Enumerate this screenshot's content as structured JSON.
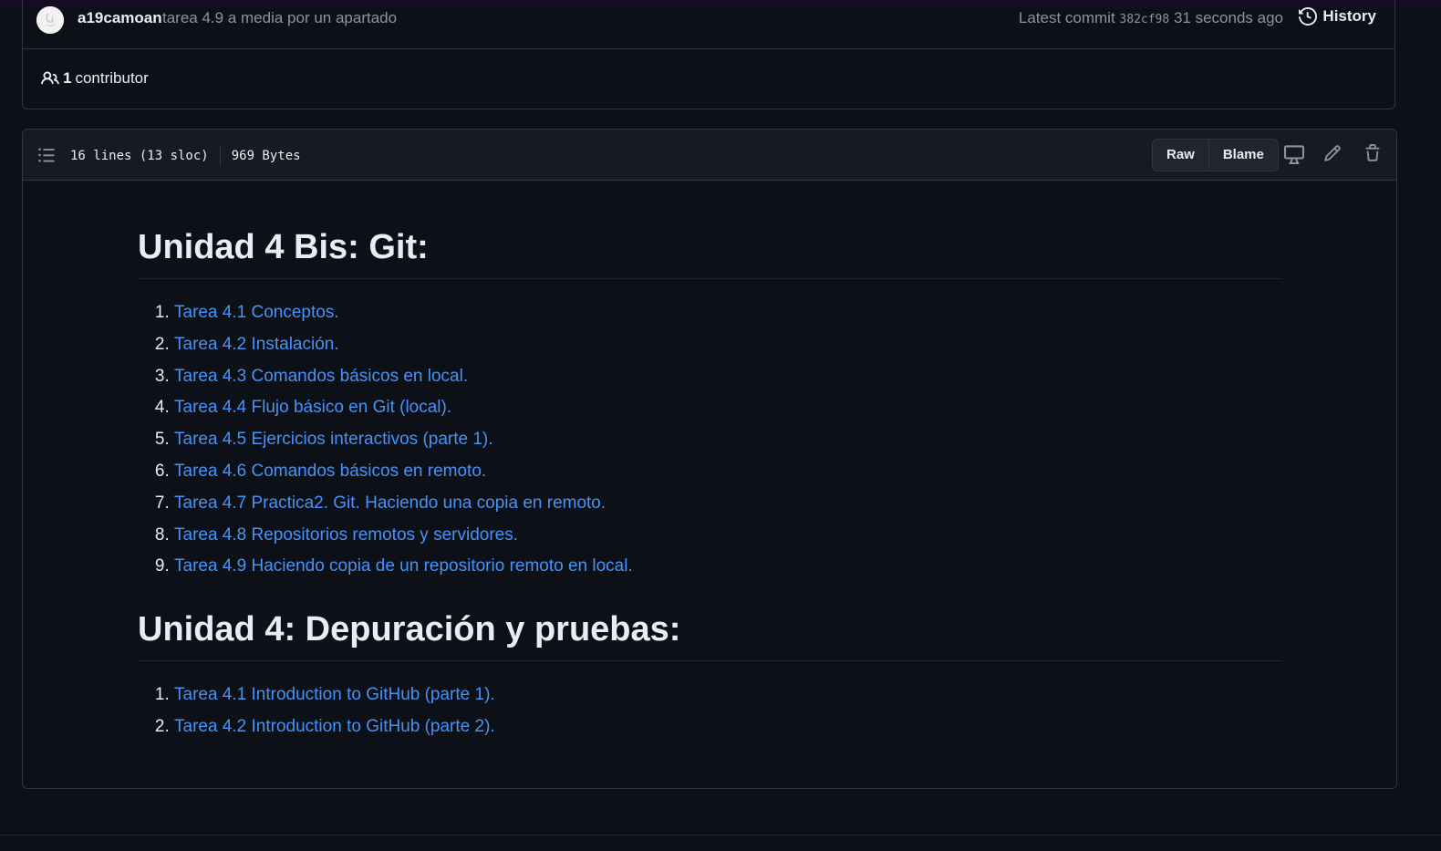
{
  "commit": {
    "author": "a19camoan",
    "message": "tarea 4.9 a media por un apartado",
    "latest_label": "Latest commit",
    "sha": "382cf98",
    "time": "31 seconds ago",
    "history_label": "History"
  },
  "contributors": {
    "count": "1",
    "label": "contributor"
  },
  "file": {
    "lines": "16 lines (13 sloc)",
    "size": "969 Bytes",
    "raw_label": "Raw",
    "blame_label": "Blame"
  },
  "icons": {
    "toc": "list-unordered-icon",
    "display": "desktop-icon",
    "edit": "pencil-icon",
    "delete": "trash-icon",
    "history": "history-icon",
    "people": "people-icon"
  },
  "markdown": {
    "heading1": "Unidad 4 Bis: Git:",
    "list1": [
      "Tarea 4.1 Conceptos.",
      "Tarea 4.2 Instalación.",
      "Tarea 4.3 Comandos básicos en local.",
      "Tarea 4.4 Flujo básico en Git (local).",
      "Tarea 4.5 Ejercicios interactivos (parte 1).",
      "Tarea 4.6 Comandos básicos en remoto.",
      "Tarea 4.7 Practica2. Git. Haciendo una copia en remoto.",
      "Tarea 4.8 Repositorios remotos y servidores.",
      "Tarea 4.9 Haciendo copia de un repositorio remoto en local."
    ],
    "heading2": "Unidad 4: Depuración y pruebas:",
    "list2": [
      "Tarea 4.1 Introduction to GitHub (parte 1).",
      "Tarea 4.2 Introduction to GitHub (parte 2)."
    ]
  },
  "colors": {
    "background": "#0d1117",
    "header_bg": "#161b22",
    "border": "#30363d",
    "link": "#4493f8",
    "text": "#e6edf3",
    "muted": "#8b949e"
  }
}
